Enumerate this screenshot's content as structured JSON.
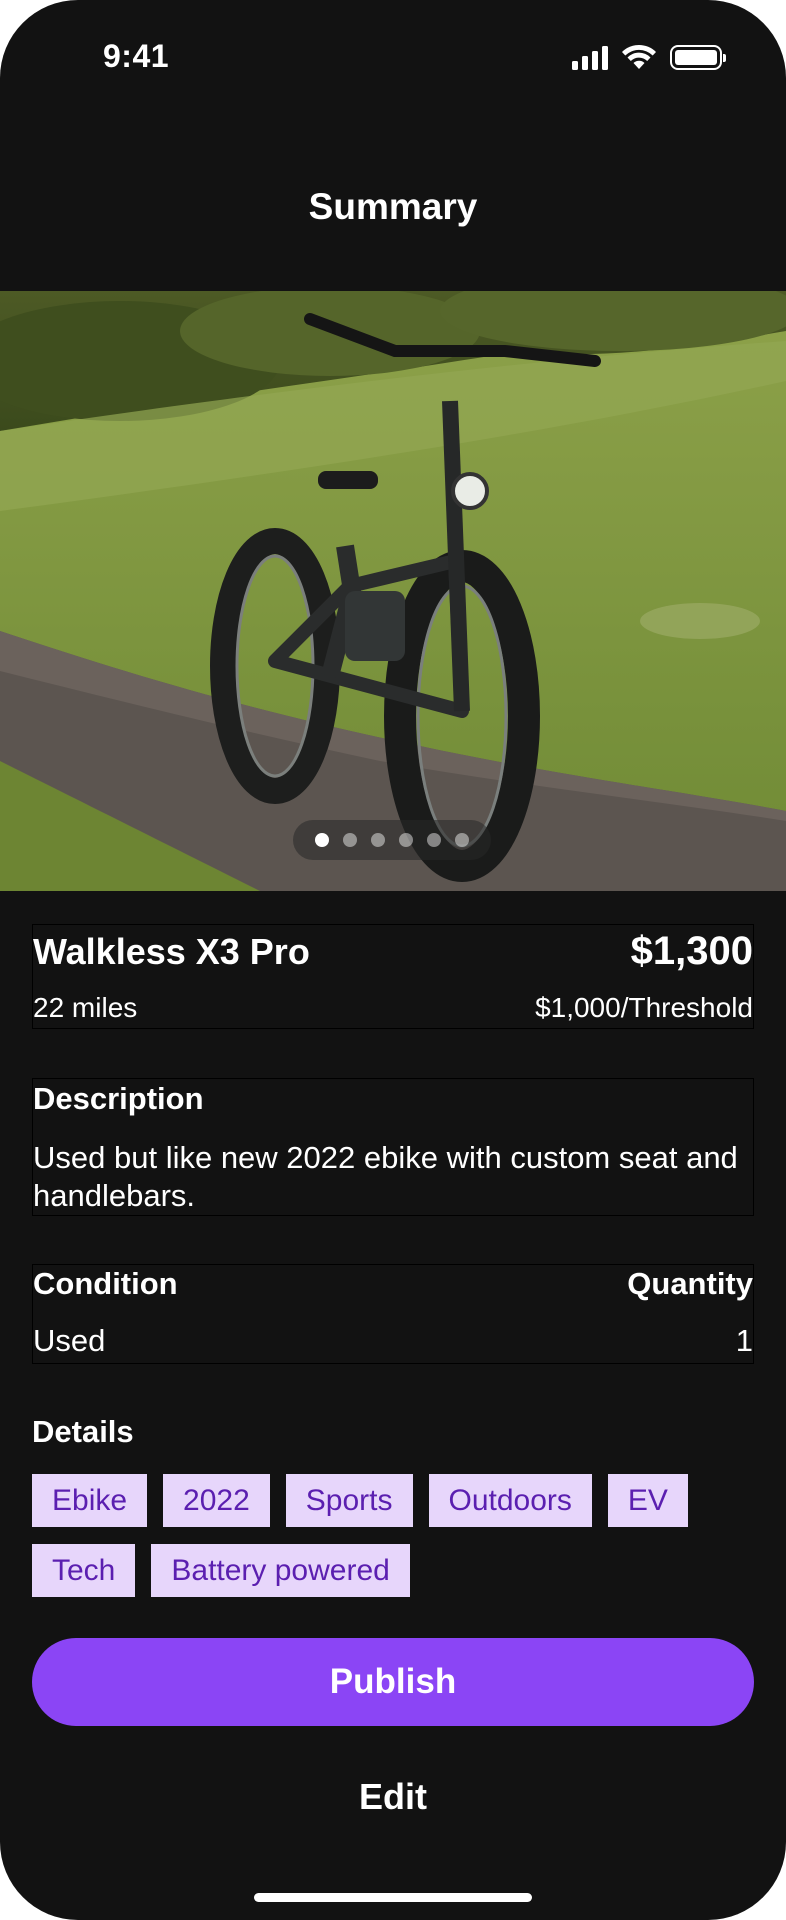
{
  "status_bar": {
    "time": "9:41"
  },
  "nav": {
    "title": "Summary"
  },
  "gallery": {
    "image_count": 6,
    "active_index": 0
  },
  "product": {
    "name": "Walkless X3 Pro",
    "price": "$1,300",
    "distance": "22 miles",
    "threshold": "$1,000/Threshold"
  },
  "description": {
    "heading": "Description",
    "text": "Used but like new 2022 ebike with custom seat and handlebars."
  },
  "condition": {
    "heading": "Condition",
    "value": "Used"
  },
  "quantity": {
    "heading": "Quantity",
    "value": "1"
  },
  "details": {
    "heading": "Details",
    "tags": [
      "Ebike",
      "2022",
      "Sports",
      "Outdoors",
      "EV",
      "Tech",
      "Battery powered"
    ]
  },
  "actions": {
    "publish_label": "Publish",
    "edit_label": "Edit"
  },
  "colors": {
    "background": "#121212",
    "accent": "#8b45f5",
    "tag_bg": "#e7d6fb",
    "tag_text": "#5b1fb0"
  }
}
